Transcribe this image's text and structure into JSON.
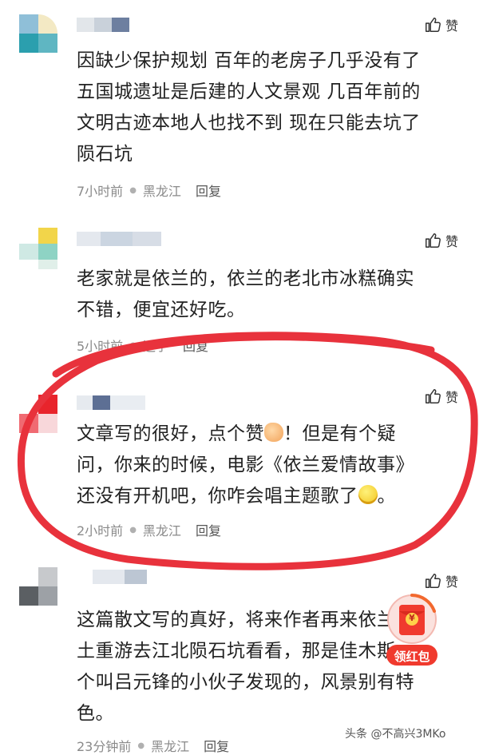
{
  "comments": [
    {
      "text_lines": [
        "因缺少保护规划 百年的老房子几乎没有了",
        "五国城遗址是后建的人文景观 几百年前的",
        "文明古迹本地人也找不到 现在只能去坑了",
        "陨石坑"
      ],
      "time": "7小时前",
      "location": "黑龙江",
      "reply_label": "回复",
      "like_label": "赞"
    },
    {
      "text_lines": [
        "老家就是依兰的，依兰的老北市冰糕确实",
        "不错，便宜还好吃。"
      ],
      "time": "5小时前",
      "location": "辽宁",
      "reply_label": "回复",
      "like_label": "赞"
    },
    {
      "text_lines": [
        "文章写的很好，点个赞",
        "！但是有个疑",
        "问，你来的时候，电影《依兰爱情故事》",
        "还没有开机吧，你咋会唱主题歌了",
        "。"
      ],
      "time": "2小时前",
      "location": "黑龙江",
      "reply_label": "回复",
      "like_label": "赞"
    },
    {
      "text_lines": [
        "这篇散文写的真好，将来作者再来依兰故",
        "土重游去江北陨石坑看看，那是佳木斯一",
        "个叫吕元锋的小伙子发现的，风景别有特",
        "色。"
      ],
      "time": "23分钟前",
      "location": "黑龙江",
      "reply_label": "回复",
      "like_label": "赞"
    }
  ],
  "red_packet": {
    "label": "领红包",
    "symbol": "¥"
  },
  "watermark": "头条 @不高兴3MKo",
  "colors": {
    "annotation_red": "#e8323c",
    "meta_gray": "#8a8a8a",
    "packet_red": "#f03a2e"
  },
  "icons": [
    "thumbs-up-icon",
    "thumbs-up-emoji-icon",
    "grin-emoji-icon",
    "red-envelope-icon"
  ]
}
